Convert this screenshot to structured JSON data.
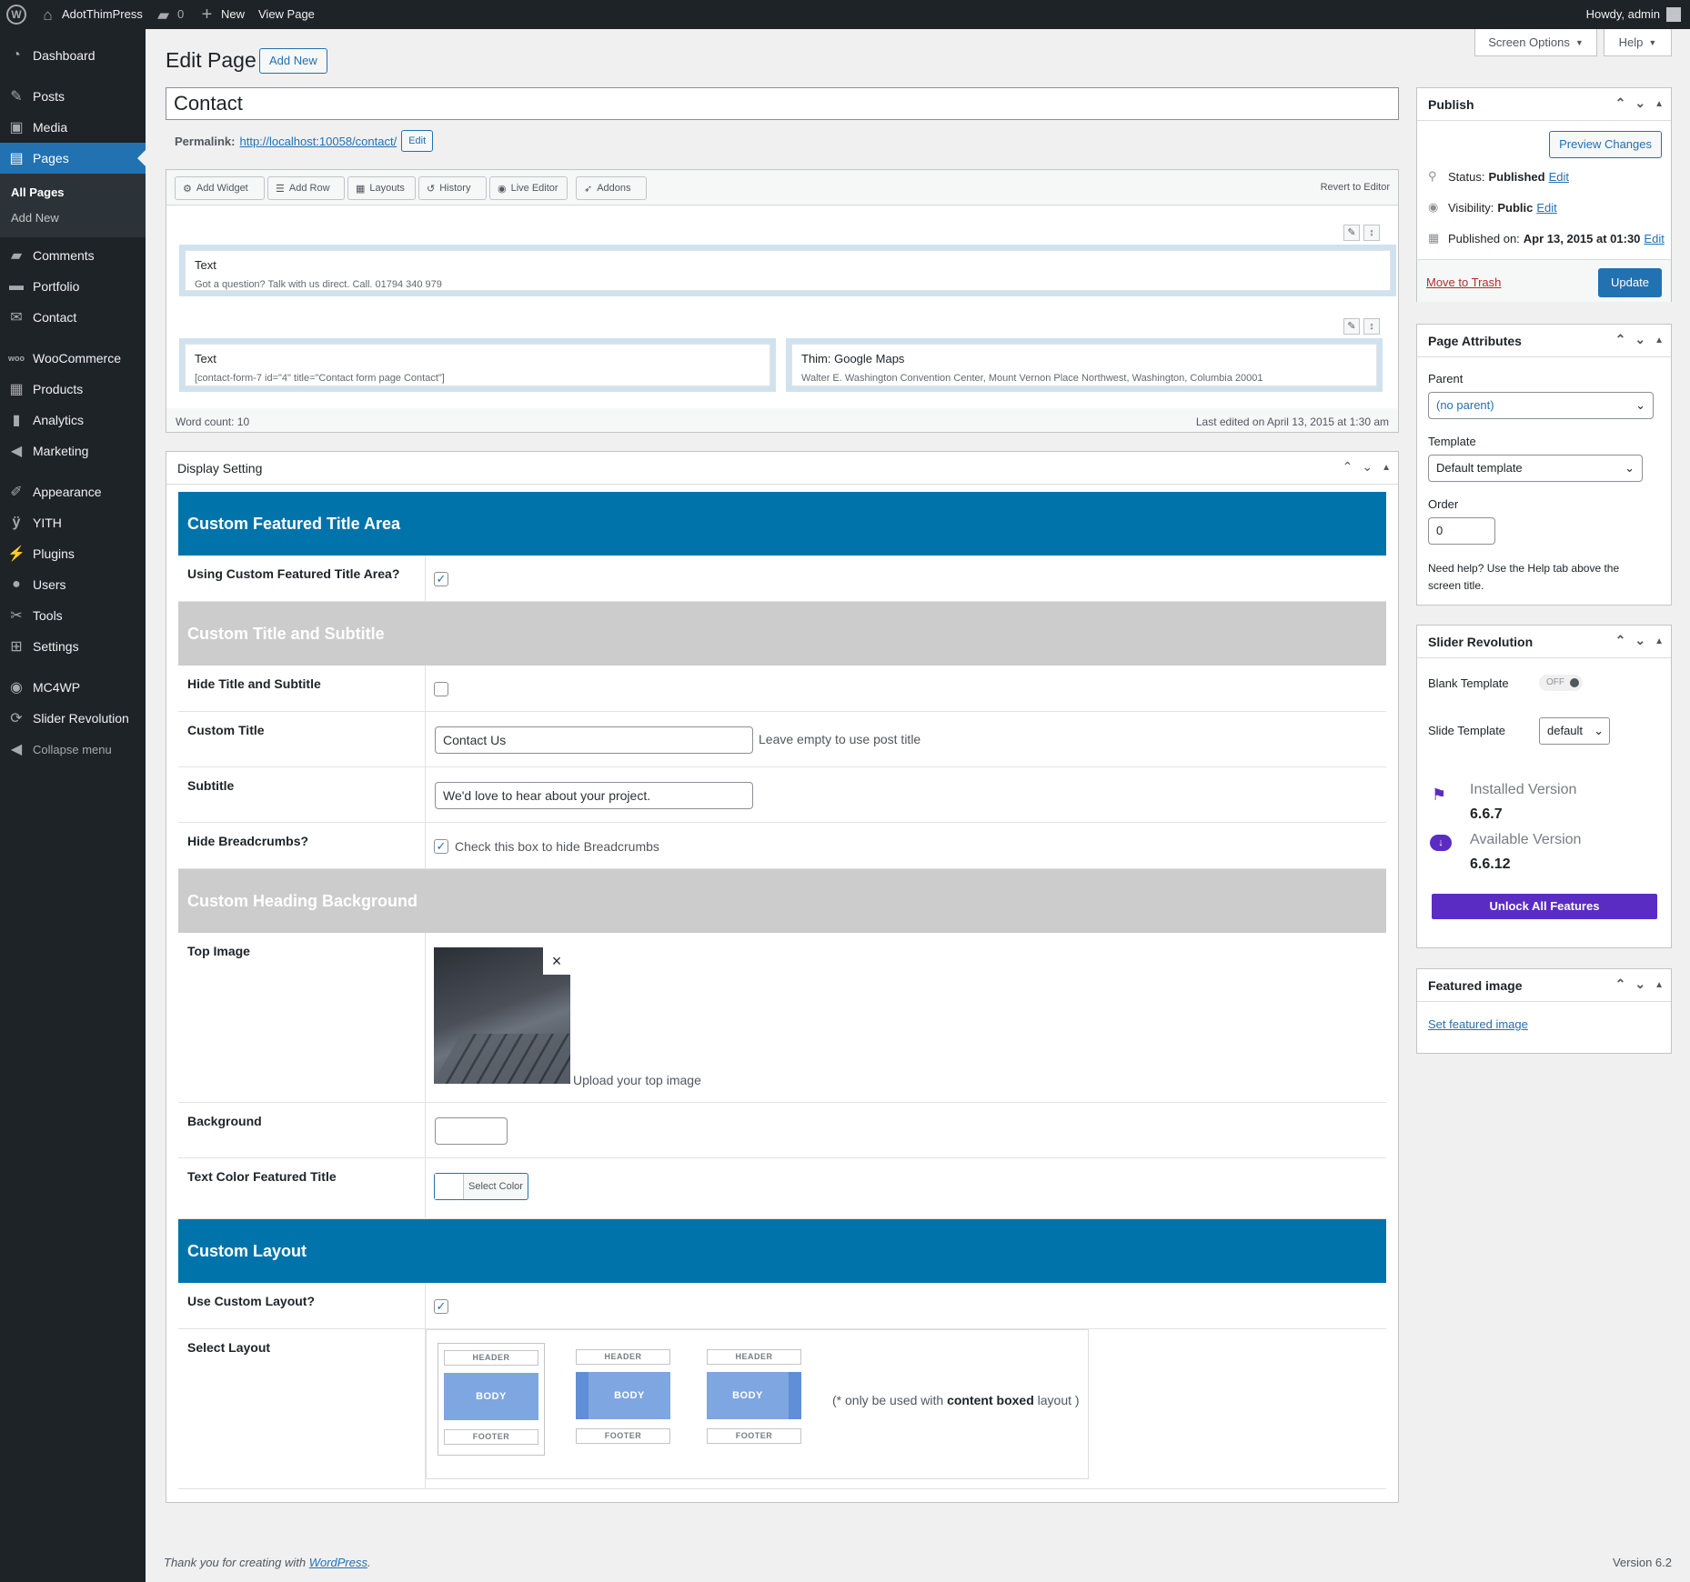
{
  "admin_bar": {
    "site_name": "AdotThimPress",
    "comments_count": "0",
    "new_label": "New",
    "view_page": "View Page",
    "howdy": "Howdy, admin"
  },
  "menu": {
    "items": [
      "Dashboard",
      "Posts",
      "Media",
      "Pages",
      "Comments",
      "Portfolio",
      "Contact",
      "WooCommerce",
      "Products",
      "Analytics",
      "Marketing",
      "Appearance",
      "YITH",
      "Plugins",
      "Users",
      "Tools",
      "Settings",
      "MC4WP",
      "Slider Revolution"
    ],
    "collapse": "Collapse menu",
    "submenu": [
      "All Pages",
      "Add New"
    ]
  },
  "top_tabs": {
    "screen_options": "Screen Options",
    "help": "Help"
  },
  "header": {
    "title": "Edit Page",
    "add_new": "Add New"
  },
  "post": {
    "title": "Contact",
    "permalink_label": "Permalink:",
    "permalink_url": "http://localhost:10058/contact/",
    "permalink_edit": "Edit"
  },
  "builder": {
    "toolbar": [
      "Add Widget",
      "Add Row",
      "Layouts",
      "History",
      "Live Editor",
      "Addons"
    ],
    "revert": "Revert to Editor",
    "w1_title": "Text",
    "w1_desc": "Got a question? Talk with us direct. Call. 01794 340 979",
    "w2_title": "Text",
    "w2_desc": "[contact-form-7 id=\"4\" title=\"Contact form page Contact\"]",
    "w3_title": "Thim: Google Maps",
    "w3_desc": "Walter E. Washington Convention Center, Mount Vernon Place Northwest, Washington, Columbia 20001",
    "word_count": "Word count: 10",
    "last_edited": "Last edited on April 13, 2015 at 1:30 am"
  },
  "display": {
    "title": "Display Setting",
    "h1": "Custom Featured Title Area",
    "r1": "Using Custom Featured Title Area?",
    "h2": "Custom Title and Subtitle",
    "r2": "Hide Title and Subtitle",
    "r3": "Custom Title",
    "r3_value": "Contact Us",
    "r3_hint": "Leave empty to use post title",
    "r4": "Subtitle",
    "r4_value": "We'd love to hear about your project.",
    "r5": "Hide Breadcrumbs?",
    "r5_hint": "Check this box to hide Breadcrumbs",
    "h3": "Custom Heading Background",
    "r6": "Top Image",
    "r6_hint": "Upload your top image",
    "r7": "Background",
    "r8": "Text Color Featured Title",
    "select_color": "Select Color",
    "h4": "Custom Layout",
    "r9": "Use Custom Layout?",
    "r10": "Select Layout",
    "layout_header": "HEADER",
    "layout_body": "BODY",
    "layout_footer": "FOOTER",
    "layout_note_a": "(* only be used with ",
    "layout_note_b": "content boxed",
    "layout_note_c": " layout )"
  },
  "publish": {
    "title": "Publish",
    "preview": "Preview Changes",
    "status_label": "Status: ",
    "status": "Published",
    "visibility_label": "Visibility: ",
    "visibility": "Public",
    "published_label": "Published on: ",
    "published": "Apr 13, 2015 at 01:30",
    "edit": "Edit",
    "trash": "Move to Trash",
    "update": "Update"
  },
  "attributes": {
    "title": "Page Attributes",
    "parent_label": "Parent",
    "parent_value": "(no parent)",
    "template_label": "Template",
    "template_value": "Default template",
    "order_label": "Order",
    "order_value": "0",
    "help": "Need help? Use the Help tab above the screen title."
  },
  "slider": {
    "title": "Slider Revolution",
    "blank_label": "Blank Template",
    "blank_toggle": "OFF",
    "slide_label": "Slide Template",
    "slide_value": "default",
    "installed_label": "Installed Version",
    "installed": "6.6.7",
    "available_label": "Available Version",
    "available": "6.6.12",
    "unlock": "Unlock All Features"
  },
  "featured": {
    "title": "Featured image",
    "set": "Set featured image"
  },
  "footer": {
    "thanks": "Thank you for creating with ",
    "wp": "WordPress",
    "thanks_end": ".",
    "version": "Version 6.2"
  },
  "colors": {
    "accent": "#2271b1",
    "heading_blue": "#0073aa",
    "heading_gray": "#cccccc",
    "purple": "#5b2cc4"
  }
}
